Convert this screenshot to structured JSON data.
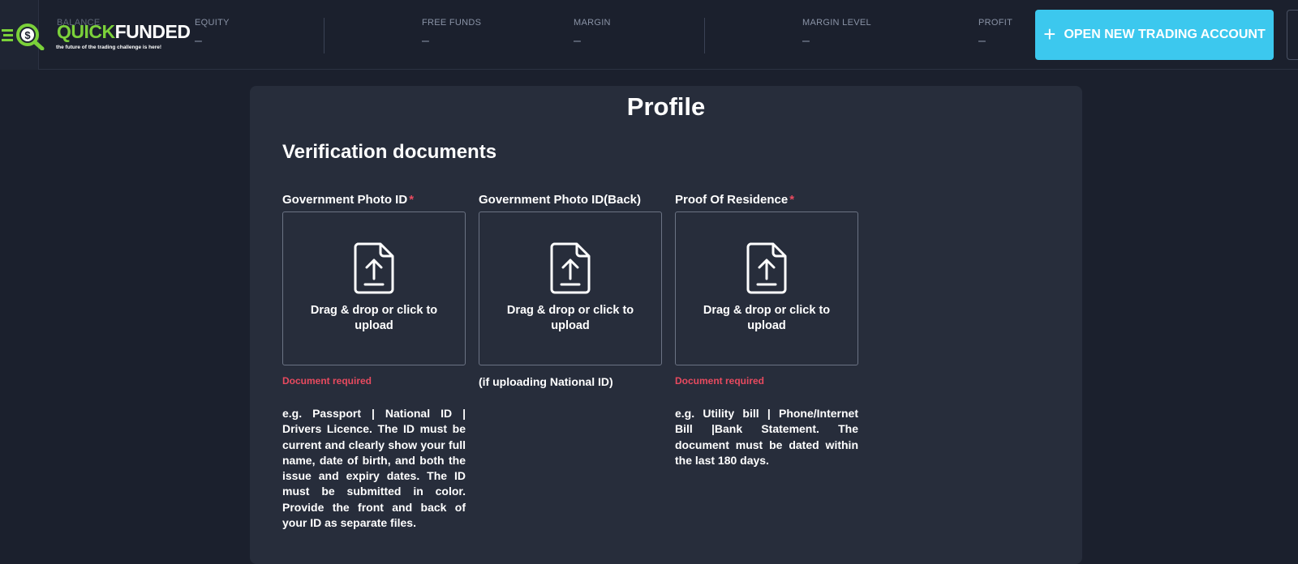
{
  "header": {
    "logo": {
      "brand_part1": "QUICK",
      "brand_part2": "FUNDED",
      "tagline": "the future of the trading challenge is here!"
    },
    "stats": [
      {
        "label": "BALANCE",
        "value": ""
      },
      {
        "label": "EQUITY",
        "value": "–"
      },
      {
        "label": "FREE FUNDS",
        "value": "–"
      },
      {
        "label": "MARGIN",
        "value": "–"
      },
      {
        "label": "MARGIN LEVEL",
        "value": "–"
      },
      {
        "label": "PROFIT",
        "value": "–"
      }
    ],
    "open_account_button": {
      "icon": "plus-icon",
      "label": "OPEN NEW TRADING ACCOUNT"
    }
  },
  "profile": {
    "title": "Profile",
    "section_title": "Verification documents",
    "documents": [
      {
        "label": "Government Photo ID",
        "required_mark": "*",
        "drop_text": "Drag & drop or click to upload",
        "error": "Document required",
        "note": "",
        "description": "e.g. Passport | National ID | Drivers Licence. The ID must be current and clearly show your full name, date of birth, and both the issue and expiry dates. The ID must be submitted in color. Provide the front and back of your ID as separate files."
      },
      {
        "label": "Government Photo ID(Back)",
        "required_mark": "",
        "drop_text": "Drag & drop or click to upload",
        "error": "",
        "note": "(if uploading National ID)",
        "description": ""
      },
      {
        "label": "Proof Of Residence",
        "required_mark": "*",
        "drop_text": "Drag & drop or click to upload",
        "error": "Document required",
        "note": "",
        "description": "e.g. Utility bill | Phone/Internet Bill |Bank Statement. The document must be dated within the last 180 days."
      }
    ]
  },
  "colors": {
    "background": "#1b202d",
    "card": "#272d3b",
    "accent": "#3cc8ee",
    "brand_green": "#7bd13a",
    "error": "#e84a5f",
    "muted": "#8a93a6"
  }
}
